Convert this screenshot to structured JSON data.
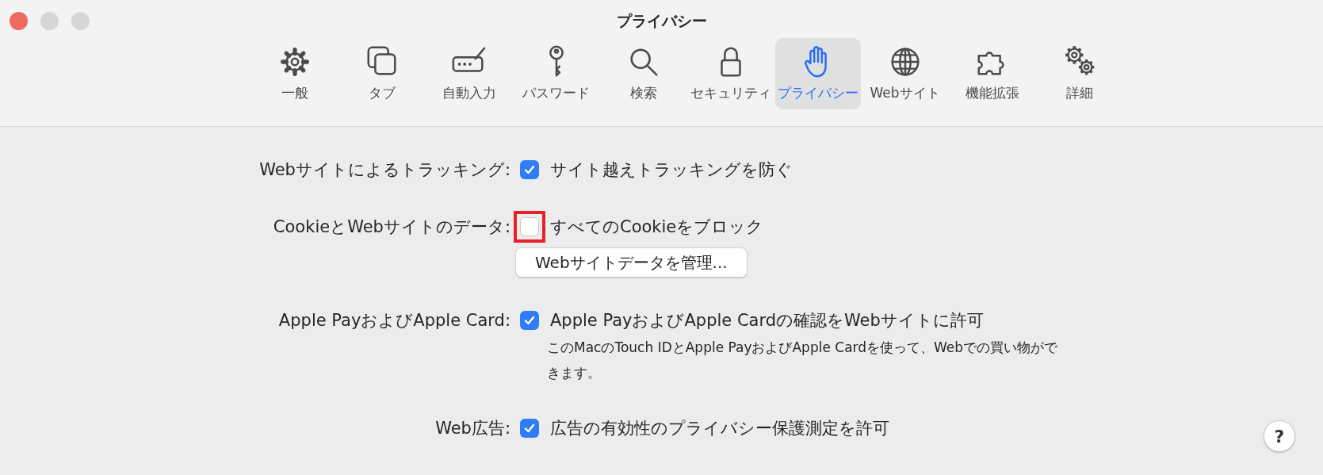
{
  "window": {
    "title": "プライバシー"
  },
  "tabs": [
    {
      "label": "一般",
      "selected": false
    },
    {
      "label": "タブ",
      "selected": false
    },
    {
      "label": "自動入力",
      "selected": false
    },
    {
      "label": "パスワード",
      "selected": false
    },
    {
      "label": "検索",
      "selected": false
    },
    {
      "label": "セキュリティ",
      "selected": false
    },
    {
      "label": "プライバシー",
      "selected": true
    },
    {
      "label": "Webサイト",
      "selected": false
    },
    {
      "label": "機能拡張",
      "selected": false
    },
    {
      "label": "詳細",
      "selected": false
    }
  ],
  "settings": [
    {
      "label": "Webサイトによるトラッキング:",
      "option": "サイト越えトラッキングを防ぐ",
      "checked": true
    },
    {
      "label": "CookieとWebサイトのデータ:",
      "option": "すべてのCookieをブロック",
      "checked": false,
      "highlighted": true,
      "button": "Webサイトデータを管理..."
    },
    {
      "label": "Apple PayおよびApple Card:",
      "option": "Apple PayおよびApple Cardの確認をWebサイトに許可",
      "checked": true,
      "note": "このMacのTouch IDとApple PayおよびApple Cardを使って、Webでの買い物ができます。"
    },
    {
      "label": "Web広告:",
      "option": "広告の有効性のプライバシー保護測定を許可",
      "checked": true
    }
  ],
  "help_button": "?"
}
